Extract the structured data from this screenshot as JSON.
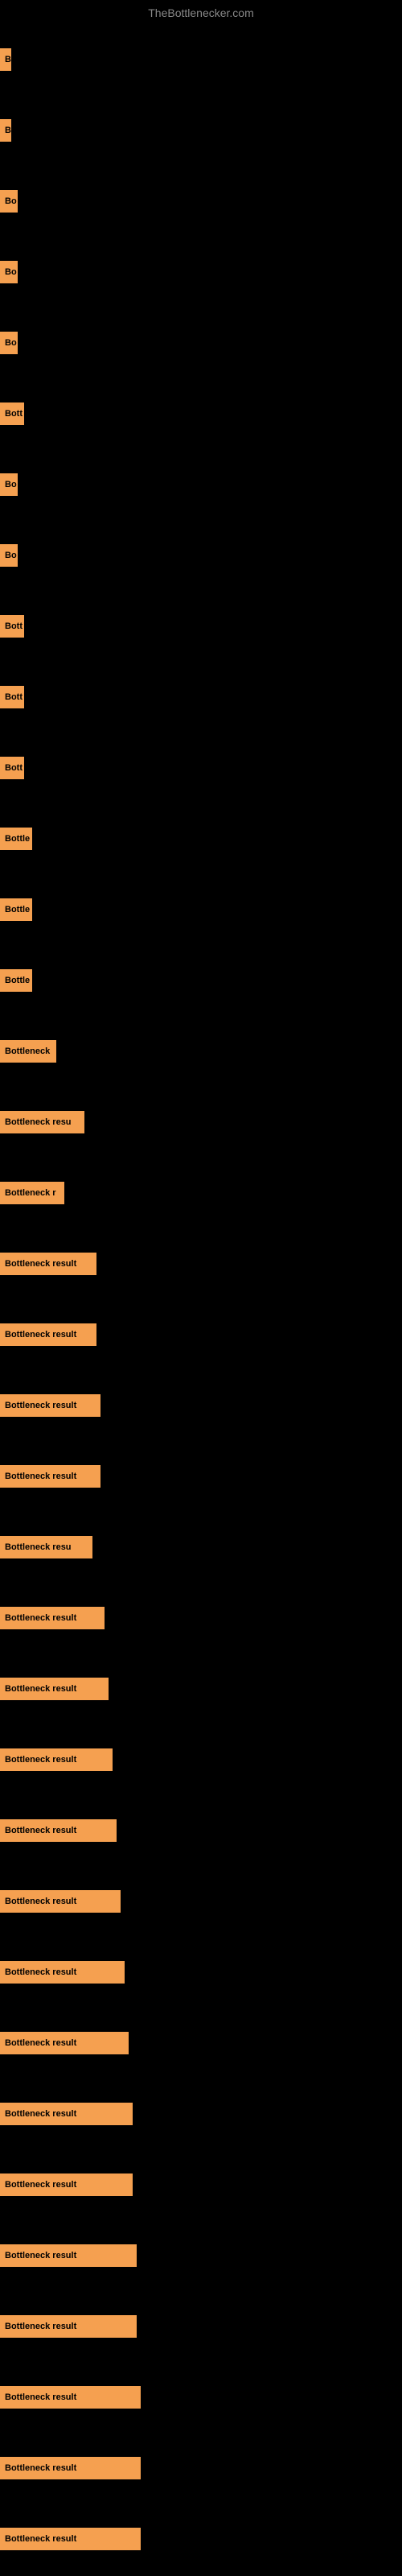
{
  "site": {
    "title": "TheBottlenecker.com"
  },
  "bars": [
    {
      "label": "B",
      "width": 14
    },
    {
      "label": "B",
      "width": 14
    },
    {
      "label": "Bo",
      "width": 22
    },
    {
      "label": "Bo",
      "width": 22
    },
    {
      "label": "Bo",
      "width": 22
    },
    {
      "label": "Bott",
      "width": 30
    },
    {
      "label": "Bo",
      "width": 22
    },
    {
      "label": "Bo",
      "width": 22
    },
    {
      "label": "Bott",
      "width": 30
    },
    {
      "label": "Bott",
      "width": 30
    },
    {
      "label": "Bott",
      "width": 30
    },
    {
      "label": "Bottle",
      "width": 40
    },
    {
      "label": "Bottle",
      "width": 40
    },
    {
      "label": "Bottle",
      "width": 40
    },
    {
      "label": "Bottleneck",
      "width": 70
    },
    {
      "label": "Bottleneck resu",
      "width": 105
    },
    {
      "label": "Bottleneck r",
      "width": 80
    },
    {
      "label": "Bottleneck result",
      "width": 120
    },
    {
      "label": "Bottleneck result",
      "width": 120
    },
    {
      "label": "Bottleneck result",
      "width": 125
    },
    {
      "label": "Bottleneck result",
      "width": 125
    },
    {
      "label": "Bottleneck resu",
      "width": 115
    },
    {
      "label": "Bottleneck result",
      "width": 130
    },
    {
      "label": "Bottleneck result",
      "width": 135
    },
    {
      "label": "Bottleneck result",
      "width": 140
    },
    {
      "label": "Bottleneck result",
      "width": 145
    },
    {
      "label": "Bottleneck result",
      "width": 150
    },
    {
      "label": "Bottleneck result",
      "width": 155
    },
    {
      "label": "Bottleneck result",
      "width": 160
    },
    {
      "label": "Bottleneck result",
      "width": 165
    },
    {
      "label": "Bottleneck result",
      "width": 165
    },
    {
      "label": "Bottleneck result",
      "width": 170
    },
    {
      "label": "Bottleneck result",
      "width": 170
    },
    {
      "label": "Bottleneck result",
      "width": 175
    },
    {
      "label": "Bottleneck result",
      "width": 175
    },
    {
      "label": "Bottleneck result",
      "width": 175
    }
  ]
}
